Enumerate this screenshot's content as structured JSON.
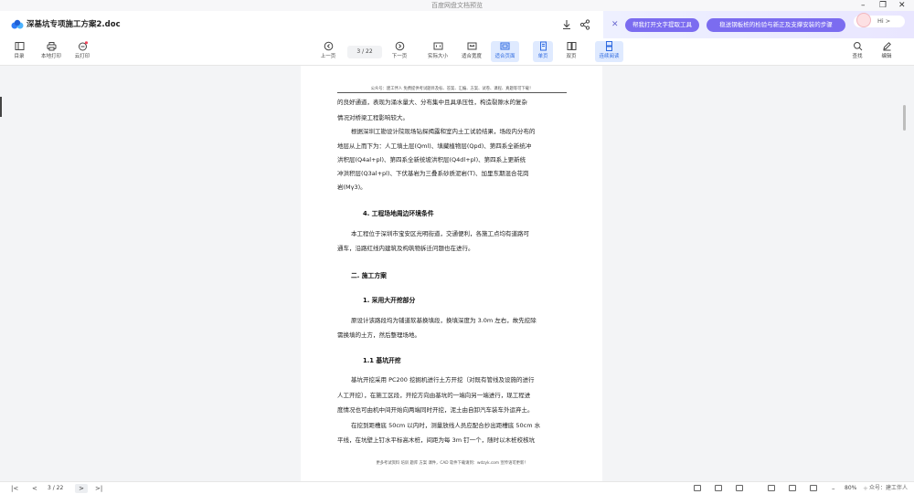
{
  "window": {
    "title": "百度网盘文档预览",
    "minimize": "–",
    "restore": "❐",
    "close": "✕"
  },
  "document": {
    "filename": "深基坑专项施工方案2.doc",
    "icons": [
      "download-icon",
      "share-icon"
    ]
  },
  "ai_panel": {
    "close": "✕",
    "pill_1": "帮我打开文字提取工具",
    "pill_2": "稳送钢板桩的检验与新正及支撑安装的步骤",
    "greeting": "Hi >"
  },
  "toolbar": {
    "left": [
      {
        "label": "目录",
        "icon": "list-icon"
      },
      {
        "label": "本地打印",
        "icon": "printer-icon"
      },
      {
        "label": "云打印",
        "icon": "cloud-printer-icon"
      }
    ],
    "prev_label": "上一页",
    "page_indicator": "3 / 22",
    "next_label": "下一页",
    "views": [
      {
        "label": "实际大小",
        "selected": false
      },
      {
        "label": "适合宽度",
        "selected": false
      },
      {
        "label": "适合页面",
        "selected": true
      },
      {
        "label": "单页",
        "selected": true
      },
      {
        "label": "双页",
        "selected": false
      },
      {
        "label": "连续阅读",
        "selected": true
      }
    ],
    "right": [
      {
        "label": "查找",
        "icon": "search-icon"
      },
      {
        "label": "编辑",
        "icon": "pen-icon"
      }
    ]
  },
  "page": {
    "header": "公众号：建工伴人  免费提供考试题目及标、答案、汇编、方案、试卷、课程、真题等可下载！",
    "lines": [
      "的良好通道，表现为涌水量大、分布集中且具承压性，构造裂隙水的复杂",
      "情况对桥梁工程影响较大。",
      "根据深圳工勘设计院现场钻探揭露和室内土工试验结果，场段内分布的",
      "地层从上而下为：人工填土层(Qml)、填藏植物层(Qpd)、第四系全新统冲",
      "洪积层(Q4al+pl)、第四系全新统坡洪积层(Q4dl+pl)、第四系上更新统",
      "冲洪积层(Q3al+pl)、下伏基岩为三叠系砂质泥岩(T)、加里东期混合花岗",
      "岩(Mγ3)。",
      "本工程位于深圳市宝安区光明街道，交通便利，各施工点均有道路可",
      "通车，沿路红线内建筑及构筑物拆迁问题也在进行。",
      "原设计该路段均为铺道软基换填段，换填深度为 3.0m 左右，故先挖除",
      "需换填的土方，然后整理场地。",
      "基坑开挖采用 PC200 挖掘机进行土方开挖（对既有管线及设施的进行",
      "人工开挖），在施工区段，开挖方向由基坑的一端向另一端进行，现工程进",
      "度情况也可由机中间开始向两端同时开挖，泥土由自卸汽车装车外运弃土。",
      "在挖到距槽底 50cm 以内时，测量放线人员应配合抄出距槽底 50cm 水",
      "平线，在坑壁上钉水平标高木桩，间距为每 3m 钉一个，随时以木桩校核坑"
    ],
    "headings": [
      "4. 工程场地周边环境条件",
      "二. 施工方案",
      "1. 采用大开挖部分",
      "1.1 基坑开挖"
    ],
    "footer": "更多考试资料  培训  题库  方案  课件，CAD 软件下载请到：wdzyk.com  宣传语可更新！"
  },
  "statusbar": {
    "first": "|<",
    "prev": "<",
    "page": "3 / 22",
    "next": ">",
    "last": ">|",
    "zoom_minus": "–",
    "zoom": "80%",
    "zoom_plus": "+",
    "watermark": "众号：建工伴人"
  }
}
